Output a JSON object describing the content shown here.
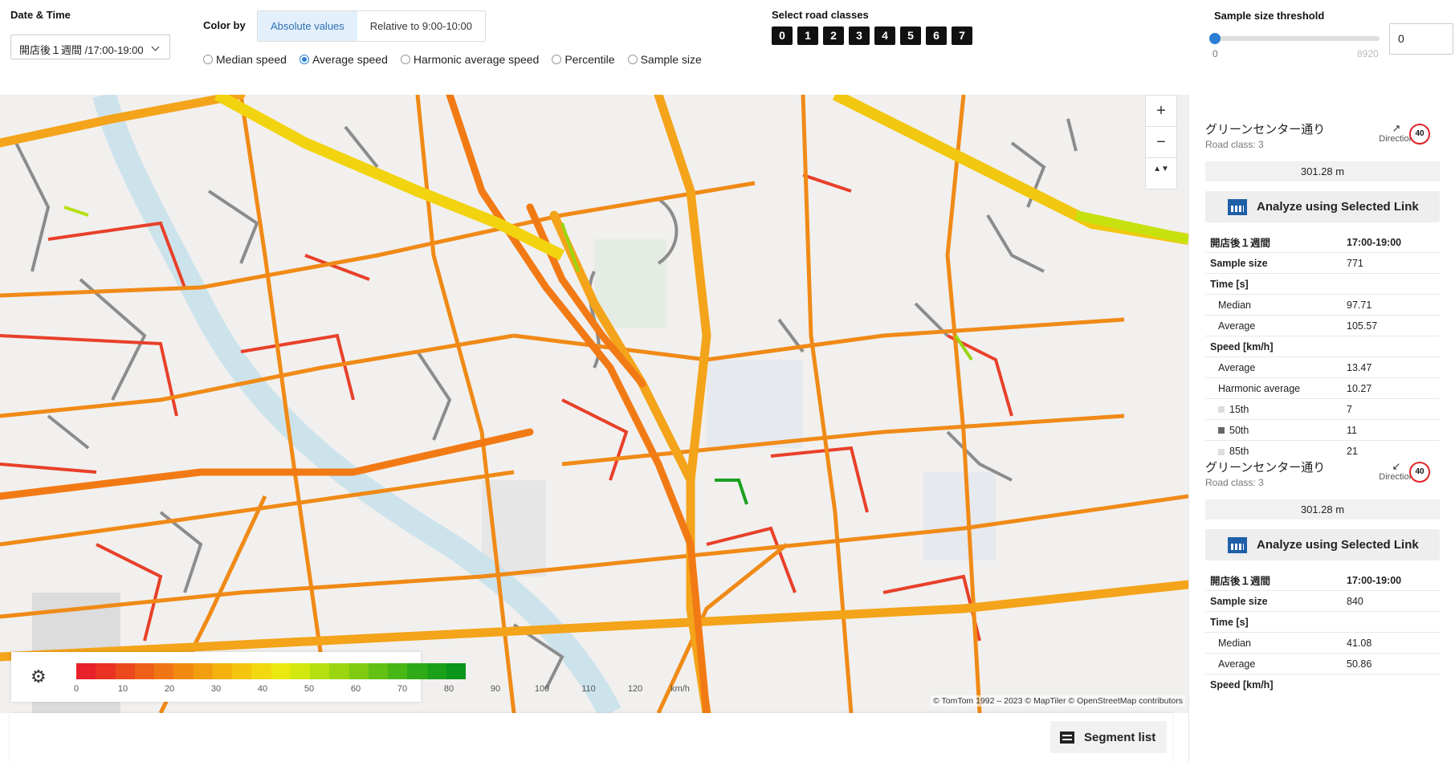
{
  "toolbar": {
    "date_time_label": "Date & Time",
    "date_time_value": "開店後１週間 /17:00-19:00",
    "color_by_label": "Color by",
    "color_by_options": [
      "Absolute values",
      "Relative to 9:00-10:00"
    ],
    "metrics": [
      "Median speed",
      "Average speed",
      "Harmonic average speed",
      "Percentile",
      "Sample size"
    ],
    "selected_metric": "Average speed",
    "road_classes_label": "Select road classes",
    "road_classes": [
      "0",
      "1",
      "2",
      "3",
      "4",
      "5",
      "6",
      "7"
    ],
    "threshold_label": "Sample size threshold",
    "threshold_min": "0",
    "threshold_max": "8920",
    "threshold_value": "0"
  },
  "map": {
    "zoom_in": "+",
    "zoom_out": "−",
    "compass": "▲▼",
    "attribution": "© TomTom 1992 – 2023  © MapTiler  © OpenStreetMap contributors"
  },
  "legend": {
    "ticks": [
      "0",
      "10",
      "20",
      "30",
      "40",
      "50",
      "60",
      "70",
      "80",
      "90",
      "100",
      "110",
      "120"
    ],
    "unit": "km/h",
    "colors": [
      "#e8202a",
      "#ea3322",
      "#ec4a1d",
      "#ee6018",
      "#f07515",
      "#f28a12",
      "#f39e10",
      "#f5b20f",
      "#f5c50e",
      "#f2d80e",
      "#e9e80f",
      "#d2e80f",
      "#b6df0f",
      "#9ad510",
      "#7ecb11",
      "#62c113",
      "#48b615",
      "#2fab17",
      "#1aa019",
      "#0a951b"
    ]
  },
  "panel": {
    "links": [
      {
        "name": "グリーンセンター通り",
        "road_class": "Road class: 3",
        "direction_label": "Direction",
        "direction_arrow": "↗",
        "speed_limit": "40",
        "length": "301.28 m",
        "analyze_label": "Analyze using Selected Link",
        "period": "開店後１週間",
        "time": "17:00-19:00",
        "sample_size_label": "Sample size",
        "sample_size": "771",
        "time_label": "Time [s]",
        "median_label": "Median",
        "median": "97.71",
        "average_label": "Average",
        "average": "105.57",
        "speed_label": "Speed [km/h]",
        "speed_avg_label": "Average",
        "speed_avg": "13.47",
        "harmonic_label": "Harmonic average",
        "harmonic": "10.27",
        "p15_label": "15th",
        "p15": "7",
        "p50_label": "50th",
        "p50": "11",
        "p85_label": "85th",
        "p85": "21"
      },
      {
        "name": "グリーンセンター通り",
        "road_class": "Road class: 3",
        "direction_label": "Direction",
        "direction_arrow": "↙",
        "speed_limit": "40",
        "length": "301.28 m",
        "analyze_label": "Analyze using Selected Link",
        "period": "開店後１週間",
        "time": "17:00-19:00",
        "sample_size_label": "Sample size",
        "sample_size": "840",
        "time_label": "Time [s]",
        "median_label": "Median",
        "median": "41.08",
        "average_label": "Average",
        "average": "50.86",
        "speed_label": "Speed [km/h]"
      }
    ]
  },
  "bottom": {
    "segment_list_label": "Segment list"
  }
}
